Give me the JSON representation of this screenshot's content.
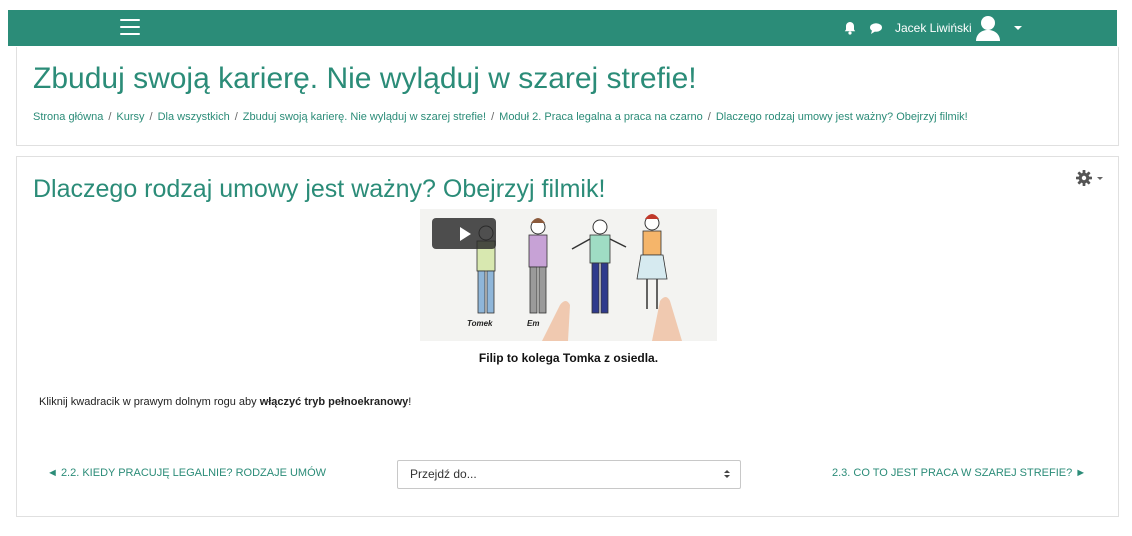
{
  "colors": {
    "brand": "#2b8c78",
    "topbar": "#2b8c78",
    "text": "#373a3c"
  },
  "topbar": {
    "menu_icon": "hamburger-icon",
    "notifications_icon": "bell-icon",
    "messages_icon": "chat-bubble-icon",
    "user_name": "Jacek Liwiński",
    "avatar_icon": "user-avatar-icon"
  },
  "header": {
    "title": "Zbuduj swoją karierę. Nie wylą​duj w szarej strefie!",
    "breadcrumb": [
      "Strona główna",
      "Kursy",
      "Dla wszystkich",
      "Zbuduj swoją karierę. Nie wylą​duj w szarej strefie!",
      "Moduł 2. Praca legalna a praca na czarno",
      "Dlaczego rodzaj umowy jest ważny? Obejrzyj filmik!"
    ],
    "separator": "/"
  },
  "activity": {
    "title": "Dlaczego rodzaj umowy jest ważny? Obejrzyj filmik!",
    "settings_icon": "gear-icon",
    "video": {
      "play_icon": "play-icon",
      "caption_labels": [
        "Tomek",
        "Em"
      ],
      "subtitle": "Filip to kolega Tomka z osiedla."
    },
    "instruction_prefix": "Kliknij kwadracik w prawym dolnym rogu aby ",
    "instruction_bold": "włączyć tryb pełnoekranowy",
    "instruction_suffix": "!"
  },
  "navigation": {
    "prev_label": "◄ 2.2. KIEDY PRACUJĘ LEGALNIE? RODZAJE UMÓW",
    "jump_placeholder": "Przejdź do...",
    "next_label": "2.3. CO TO JEST PRACA W SZAREJ STREFIE? ►"
  }
}
